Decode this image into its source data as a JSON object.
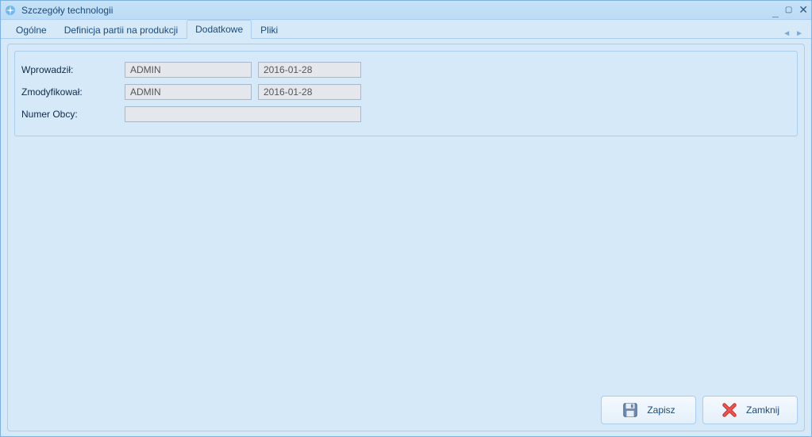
{
  "window": {
    "title": "Szczegóły technologii"
  },
  "tabs": [
    {
      "label": "Ogólne",
      "active": false
    },
    {
      "label": "Definicja partii na produkcji",
      "active": false
    },
    {
      "label": "Dodatkowe",
      "active": true
    },
    {
      "label": "Pliki",
      "active": false
    }
  ],
  "labels": {
    "created_by": "Wprowadził:",
    "modified_by": "Zmodyfikował:",
    "foreign_no": "Numer Obcy:"
  },
  "fields": {
    "created_by_user": "ADMIN",
    "created_date": "2016-01-28",
    "modified_by_user": "ADMIN",
    "modified_date": "2016-01-28",
    "foreign_no_value": ""
  },
  "buttons": {
    "save": "Zapisz",
    "close": "Zamknij"
  }
}
